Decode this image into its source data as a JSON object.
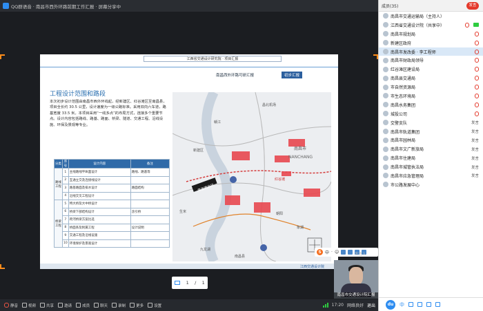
{
  "window": {
    "title": "QQ群语音 · 南昌市西外环路前期工作汇报 · 屏幕分享中"
  },
  "slide": {
    "header": "江西省交通设计研究院 · 项目汇报",
    "subhead": "南昌西外环路可研汇报",
    "tag": "初步汇报",
    "title": "工程设计范围和路段",
    "paragraph": "本次初步设计范围由南昌市西外环线起，经新建区、红谷滩区至南昌县，项目全长约 30.5 公里，设计速度为一级公路标准。采用双向六车道，路基宽度 33.5 米。本项目采用“一线多点”的布局方式，连接多个重要节点。设计内容包括路线、路基、路面、桥梁、隧道、交通工程、沿线设施、环保及景观等专业。",
    "table": {
      "headers": [
        "分类",
        "序号",
        "设计内容",
        "备注"
      ],
      "groups": [
        {
          "group": "路线工程",
          "rows": [
            {
              "num": "1",
              "content": "主线路线平纵面设计",
              "note": "路线、路基等"
            },
            {
              "num": "2",
              "content": "互通立交及连接线设计",
              "note": ""
            },
            {
              "num": "3",
              "content": "路基路面及排水设计",
              "note": "路面结构"
            },
            {
              "num": "4",
              "content": "沿线交叉工程设计",
              "note": ""
            }
          ]
        },
        {
          "group": "桥梁工程",
          "rows": [
            {
              "num": "5",
              "content": "特大桥及大中桥设计",
              "note": ""
            },
            {
              "num": "6",
              "content": "桥梁下部结构设计",
              "note": "含引桥"
            },
            {
              "num": "7",
              "content": "跨河桥梁方案比选",
              "note": ""
            },
            {
              "num": "8",
              "content": "桥面系及附属工程",
              "note": "设计说明"
            },
            {
              "num": "9",
              "content": "交通工程及沿线设施",
              "note": ""
            },
            {
              "num": "10",
              "content": "环境保护及景观设计",
              "note": ""
            }
          ]
        }
      ]
    },
    "map": {
      "labels": [
        "南昌市",
        "NANCHANG",
        "红谷滩",
        "新建区",
        "九龙湖",
        "赣江",
        "朝阳",
        "象湖",
        "昌北机场",
        "生米",
        "南昌县"
      ],
      "route_label": "南昌西外环"
    },
    "footer_brand": "江西交通设计院"
  },
  "pager": {
    "current": "1",
    "separator": "/",
    "total": "1"
  },
  "ime": {
    "logo": "S",
    "items": [
      "中",
      "·",
      "☺",
      "🎤",
      "⌨",
      "👕",
      "⚙"
    ]
  },
  "video": {
    "top_label": "发言人",
    "label": "南昌市交通设计院汇报"
  },
  "toolbar": {
    "items": [
      "静音",
      "视频",
      "共享",
      "邀请",
      "成员",
      "聊天",
      "录制",
      "更多",
      "设置"
    ],
    "time": "17:20",
    "net": "网络良好",
    "exit": "退出"
  },
  "panel": {
    "title": "成员(35)",
    "hd_label": "发言",
    "members": [
      {
        "name": "南昌市交通运输局（主持人）",
        "status": "",
        "mic": false,
        "cam": false,
        "highlight": false
      },
      {
        "name": "江西省交通设计院（共享中）",
        "status": "",
        "mic": true,
        "cam": true,
        "highlight": false
      },
      {
        "name": "南昌市规划局",
        "status": "",
        "mic": true,
        "cam": false,
        "highlight": false
      },
      {
        "name": "新建区政府",
        "status": "",
        "mic": true,
        "cam": false,
        "highlight": false
      },
      {
        "name": "南昌市发改委 · 李工程师",
        "status": "",
        "mic": true,
        "cam": false,
        "highlight": true
      },
      {
        "name": "南昌市财政局领导",
        "status": "",
        "mic": true,
        "cam": false,
        "highlight": false
      },
      {
        "name": "红谷滩区建设局",
        "status": "",
        "mic": true,
        "cam": false,
        "highlight": false
      },
      {
        "name": "南昌县交通局",
        "status": "",
        "mic": true,
        "cam": false,
        "highlight": false
      },
      {
        "name": "市自然资源局",
        "status": "",
        "mic": true,
        "cam": false,
        "highlight": false
      },
      {
        "name": "市生态环境局",
        "status": "",
        "mic": true,
        "cam": false,
        "highlight": false
      },
      {
        "name": "南昌水务集团",
        "status": "",
        "mic": true,
        "cam": false,
        "highlight": false
      },
      {
        "name": "城投公司",
        "status": "",
        "mic": true,
        "cam": false,
        "highlight": false
      },
      {
        "name": "交警支队",
        "status": "发言",
        "mic": false,
        "cam": false,
        "highlight": false
      },
      {
        "name": "南昌市轨道集团",
        "status": "发言",
        "mic": false,
        "cam": false,
        "highlight": false
      },
      {
        "name": "南昌市园林局",
        "status": "发言",
        "mic": false,
        "cam": false,
        "highlight": false
      },
      {
        "name": "南昌市文广新旅局",
        "status": "发言",
        "mic": false,
        "cam": false,
        "highlight": false
      },
      {
        "name": "南昌市住建局",
        "status": "发言",
        "mic": false,
        "cam": false,
        "highlight": false
      },
      {
        "name": "南昌市城管执法局",
        "status": "发言",
        "mic": false,
        "cam": false,
        "highlight": false
      },
      {
        "name": "南昌市应急管理局",
        "status": "发言",
        "mic": false,
        "cam": false,
        "highlight": false
      },
      {
        "name": "市公路发展中心",
        "status": "",
        "mic": false,
        "cam": false,
        "highlight": false
      }
    ],
    "footer_logo": "du",
    "footer_text": "中"
  }
}
